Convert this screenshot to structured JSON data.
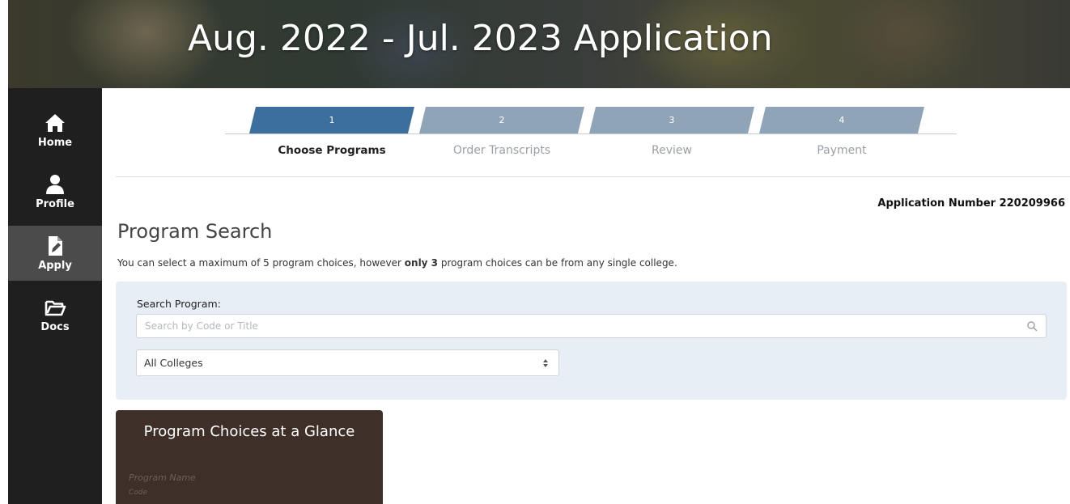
{
  "banner": {
    "title": "Aug. 2022 - Jul. 2023 Application"
  },
  "sidebar": {
    "items": [
      {
        "label": "Home",
        "icon": "home-icon"
      },
      {
        "label": "Profile",
        "icon": "user-icon"
      },
      {
        "label": "Apply",
        "icon": "edit-document-icon"
      },
      {
        "label": "Docs",
        "icon": "folder-icon"
      }
    ],
    "active": "Apply"
  },
  "steps": [
    {
      "number": "1",
      "label": "Choose Programs"
    },
    {
      "number": "2",
      "label": "Order Transcripts"
    },
    {
      "number": "3",
      "label": "Review"
    },
    {
      "number": "4",
      "label": "Payment"
    }
  ],
  "current_step": "1",
  "application_number": "Application Number 220209966",
  "page": {
    "title": "Program Search",
    "intro_before": "You can select a maximum of 5 program choices, however ",
    "intro_bold": "only 3",
    "intro_after": " program choices can be from any single college."
  },
  "search": {
    "label": "Search Program:",
    "placeholder": "Search by Code or Title",
    "college_selected": "All Colleges"
  },
  "glance": {
    "title": "Program Choices at a Glance",
    "program_name": "Program Name",
    "code": "Code"
  },
  "colors": {
    "active_step": "#3d6f9e",
    "inactive_step": "#8fa5b7",
    "sidebar_bg": "#1f1f1f",
    "card_bg": "#3e2f28",
    "search_panel_bg": "#e8eef6"
  }
}
